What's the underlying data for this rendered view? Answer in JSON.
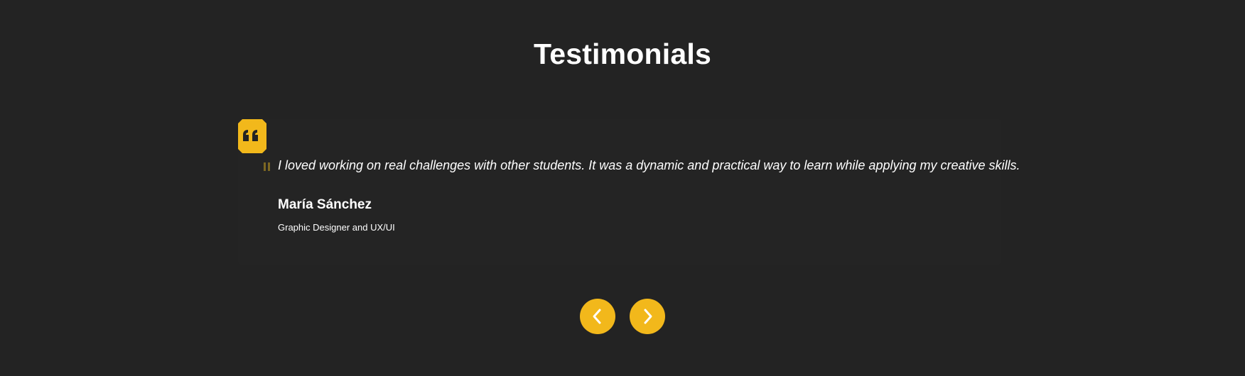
{
  "section": {
    "title": "Testimonials"
  },
  "testimonial": {
    "quote": "I loved working on real challenges with other students. It was a dynamic and practical way to learn while applying my creative skills.",
    "author_name": "María Sánchez",
    "author_role": "Graphic Designer and UX/UI"
  },
  "navigation": {
    "previous_icon": "chevron-left-icon",
    "next_icon": "chevron-right-icon"
  },
  "icons": {
    "quote_badge": "quote-icon",
    "quote_mark": "quote-mark-icon"
  },
  "colors": {
    "background": "#232323",
    "accent": "#f2b81b",
    "text": "#ffffff"
  }
}
